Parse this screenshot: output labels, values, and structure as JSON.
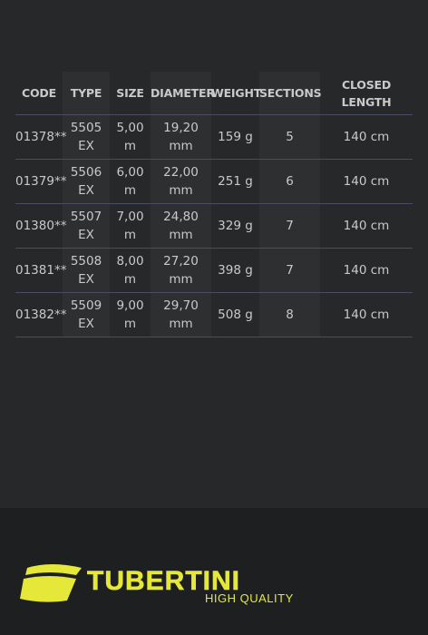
{
  "table": {
    "headers": {
      "code": "CODE",
      "type": "TYPE",
      "size": "SIZE",
      "diameter": "DIAMETER",
      "weight": "WEIGHT",
      "sections": "SECTIONS",
      "closed_length_1": "CLOSED",
      "closed_length_2": "LENGTH"
    },
    "rows": [
      {
        "code": "01378**",
        "type_1": "5505",
        "type_2": "EX",
        "size_1": "5,00",
        "size_2": "m",
        "diameter_1": "19,20 mm",
        "diameter_2": "",
        "weight": "159 g",
        "sections": "5",
        "closed_length": "140 cm"
      },
      {
        "code": "01379**",
        "type_1": "5506",
        "type_2": "EX",
        "size_1": "6,00",
        "size_2": "m",
        "diameter_1": "22,00",
        "diameter_2": "mm",
        "weight": "251 g",
        "sections": "6",
        "closed_length": "140 cm"
      },
      {
        "code": "01380**",
        "type_1": "5507",
        "type_2": "EX",
        "size_1": "7,00 m",
        "size_2": "",
        "diameter_1": "24,80",
        "diameter_2": "mm",
        "weight": "329 g",
        "sections": "7",
        "closed_length": "140 cm"
      },
      {
        "code": "01381**",
        "type_1": "5508",
        "type_2": "EX",
        "size_1": "8,00",
        "size_2": "m",
        "diameter_1": "27,20 mm",
        "diameter_2": "",
        "weight": "398 g",
        "sections": "7",
        "closed_length": "140 cm"
      },
      {
        "code": "01382**",
        "type_1": "5509",
        "type_2": "EX",
        "size_1": "9,00",
        "size_2": "m",
        "diameter_1": "29,70",
        "diameter_2": "mm",
        "weight": "508 g",
        "sections": "8",
        "closed_length": "140 cm"
      }
    ]
  },
  "footer": {
    "brand": "TUBERTINI",
    "tagline": "HIGH QUALITY",
    "brand_color": "#e5e838",
    "logo_icon": "tubertini-swoosh-icon"
  }
}
